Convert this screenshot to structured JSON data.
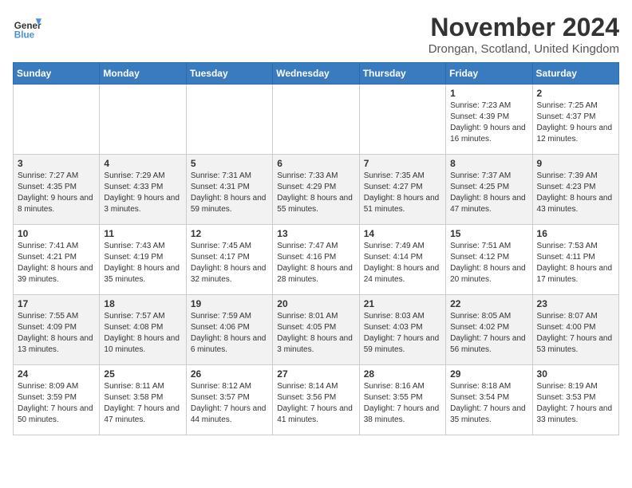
{
  "header": {
    "logo_line1": "General",
    "logo_line2": "Blue",
    "month": "November 2024",
    "location": "Drongan, Scotland, United Kingdom"
  },
  "weekdays": [
    "Sunday",
    "Monday",
    "Tuesday",
    "Wednesday",
    "Thursday",
    "Friday",
    "Saturday"
  ],
  "weeks": [
    [
      {
        "day": "",
        "info": ""
      },
      {
        "day": "",
        "info": ""
      },
      {
        "day": "",
        "info": ""
      },
      {
        "day": "",
        "info": ""
      },
      {
        "day": "",
        "info": ""
      },
      {
        "day": "1",
        "info": "Sunrise: 7:23 AM\nSunset: 4:39 PM\nDaylight: 9 hours and 16 minutes."
      },
      {
        "day": "2",
        "info": "Sunrise: 7:25 AM\nSunset: 4:37 PM\nDaylight: 9 hours and 12 minutes."
      }
    ],
    [
      {
        "day": "3",
        "info": "Sunrise: 7:27 AM\nSunset: 4:35 PM\nDaylight: 9 hours and 8 minutes."
      },
      {
        "day": "4",
        "info": "Sunrise: 7:29 AM\nSunset: 4:33 PM\nDaylight: 9 hours and 3 minutes."
      },
      {
        "day": "5",
        "info": "Sunrise: 7:31 AM\nSunset: 4:31 PM\nDaylight: 8 hours and 59 minutes."
      },
      {
        "day": "6",
        "info": "Sunrise: 7:33 AM\nSunset: 4:29 PM\nDaylight: 8 hours and 55 minutes."
      },
      {
        "day": "7",
        "info": "Sunrise: 7:35 AM\nSunset: 4:27 PM\nDaylight: 8 hours and 51 minutes."
      },
      {
        "day": "8",
        "info": "Sunrise: 7:37 AM\nSunset: 4:25 PM\nDaylight: 8 hours and 47 minutes."
      },
      {
        "day": "9",
        "info": "Sunrise: 7:39 AM\nSunset: 4:23 PM\nDaylight: 8 hours and 43 minutes."
      }
    ],
    [
      {
        "day": "10",
        "info": "Sunrise: 7:41 AM\nSunset: 4:21 PM\nDaylight: 8 hours and 39 minutes."
      },
      {
        "day": "11",
        "info": "Sunrise: 7:43 AM\nSunset: 4:19 PM\nDaylight: 8 hours and 35 minutes."
      },
      {
        "day": "12",
        "info": "Sunrise: 7:45 AM\nSunset: 4:17 PM\nDaylight: 8 hours and 32 minutes."
      },
      {
        "day": "13",
        "info": "Sunrise: 7:47 AM\nSunset: 4:16 PM\nDaylight: 8 hours and 28 minutes."
      },
      {
        "day": "14",
        "info": "Sunrise: 7:49 AM\nSunset: 4:14 PM\nDaylight: 8 hours and 24 minutes."
      },
      {
        "day": "15",
        "info": "Sunrise: 7:51 AM\nSunset: 4:12 PM\nDaylight: 8 hours and 20 minutes."
      },
      {
        "day": "16",
        "info": "Sunrise: 7:53 AM\nSunset: 4:11 PM\nDaylight: 8 hours and 17 minutes."
      }
    ],
    [
      {
        "day": "17",
        "info": "Sunrise: 7:55 AM\nSunset: 4:09 PM\nDaylight: 8 hours and 13 minutes."
      },
      {
        "day": "18",
        "info": "Sunrise: 7:57 AM\nSunset: 4:08 PM\nDaylight: 8 hours and 10 minutes."
      },
      {
        "day": "19",
        "info": "Sunrise: 7:59 AM\nSunset: 4:06 PM\nDaylight: 8 hours and 6 minutes."
      },
      {
        "day": "20",
        "info": "Sunrise: 8:01 AM\nSunset: 4:05 PM\nDaylight: 8 hours and 3 minutes."
      },
      {
        "day": "21",
        "info": "Sunrise: 8:03 AM\nSunset: 4:03 PM\nDaylight: 7 hours and 59 minutes."
      },
      {
        "day": "22",
        "info": "Sunrise: 8:05 AM\nSunset: 4:02 PM\nDaylight: 7 hours and 56 minutes."
      },
      {
        "day": "23",
        "info": "Sunrise: 8:07 AM\nSunset: 4:00 PM\nDaylight: 7 hours and 53 minutes."
      }
    ],
    [
      {
        "day": "24",
        "info": "Sunrise: 8:09 AM\nSunset: 3:59 PM\nDaylight: 7 hours and 50 minutes."
      },
      {
        "day": "25",
        "info": "Sunrise: 8:11 AM\nSunset: 3:58 PM\nDaylight: 7 hours and 47 minutes."
      },
      {
        "day": "26",
        "info": "Sunrise: 8:12 AM\nSunset: 3:57 PM\nDaylight: 7 hours and 44 minutes."
      },
      {
        "day": "27",
        "info": "Sunrise: 8:14 AM\nSunset: 3:56 PM\nDaylight: 7 hours and 41 minutes."
      },
      {
        "day": "28",
        "info": "Sunrise: 8:16 AM\nSunset: 3:55 PM\nDaylight: 7 hours and 38 minutes."
      },
      {
        "day": "29",
        "info": "Sunrise: 8:18 AM\nSunset: 3:54 PM\nDaylight: 7 hours and 35 minutes."
      },
      {
        "day": "30",
        "info": "Sunrise: 8:19 AM\nSunset: 3:53 PM\nDaylight: 7 hours and 33 minutes."
      }
    ]
  ]
}
